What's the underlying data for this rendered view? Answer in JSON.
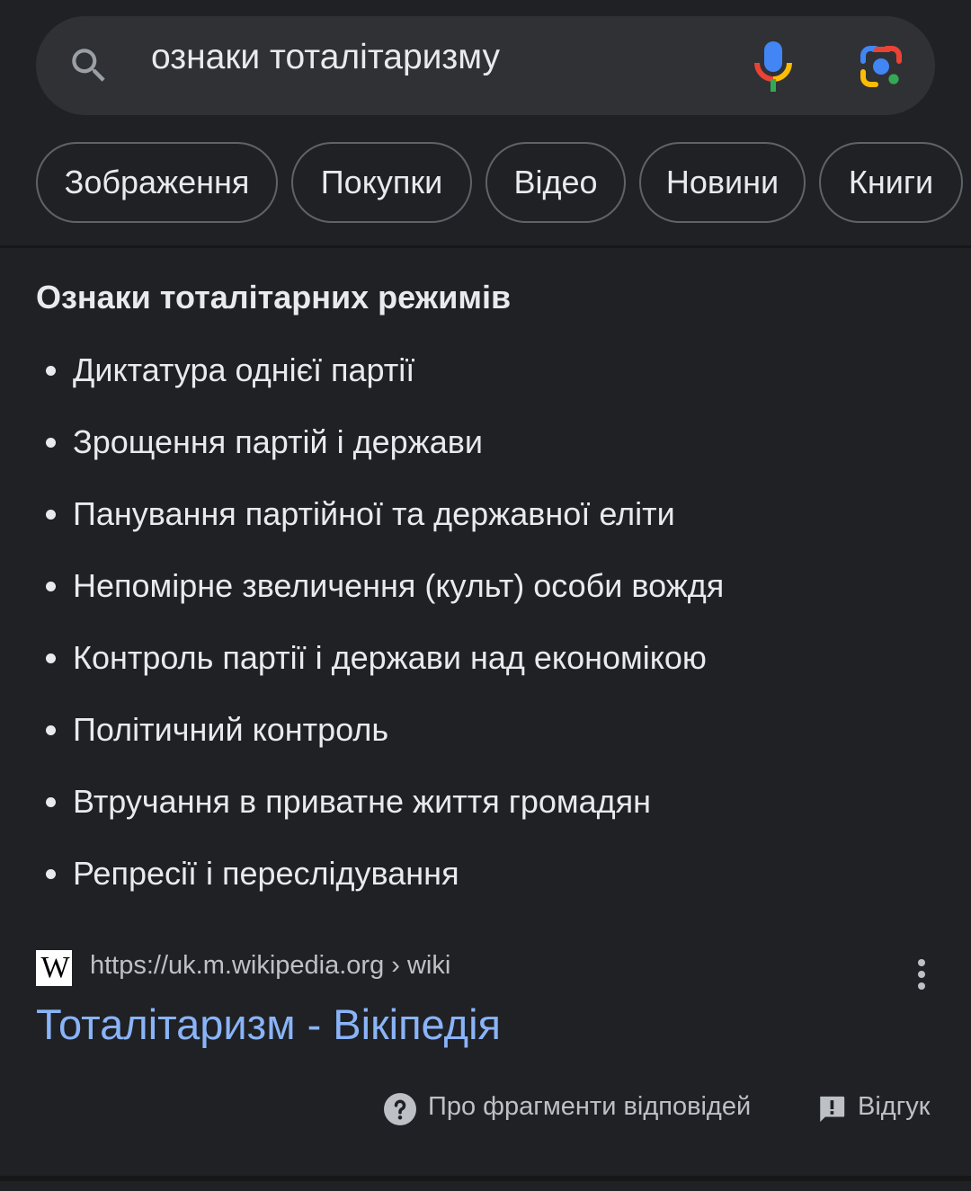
{
  "search": {
    "query": "ознаки тоталітаризму",
    "icons": [
      "search-icon",
      "mic-icon",
      "lens-icon"
    ]
  },
  "chips": [
    {
      "label": "Зображення"
    },
    {
      "label": "Покупки"
    },
    {
      "label": "Відео"
    },
    {
      "label": "Новини"
    },
    {
      "label": "Книги"
    }
  ],
  "snippet": {
    "title": "Ознаки тоталітарних режимів",
    "items": [
      "Диктатура однієї партії",
      "Зрощення партій і держави",
      "Панування партійної та державної еліти",
      "Непомірне звеличення (культ) особи вождя",
      "Контроль партії і держави над економікою",
      "Політичний контроль",
      "Втручання в приватне життя громадян",
      "Репресії і переслідування"
    ]
  },
  "source": {
    "logo_text": "W",
    "url": "https://uk.m.wikipedia.org › wiki",
    "title": "Тоталітаризм - Вікіпедія"
  },
  "footer": {
    "about_label": "Про фрагменти відповідей",
    "feedback_label": "Відгук"
  },
  "colors": {
    "background": "#202124",
    "surface": "#303134",
    "link": "#8ab4f8",
    "text": "#e8eaed",
    "secondary_text": "#bdc1c6"
  }
}
